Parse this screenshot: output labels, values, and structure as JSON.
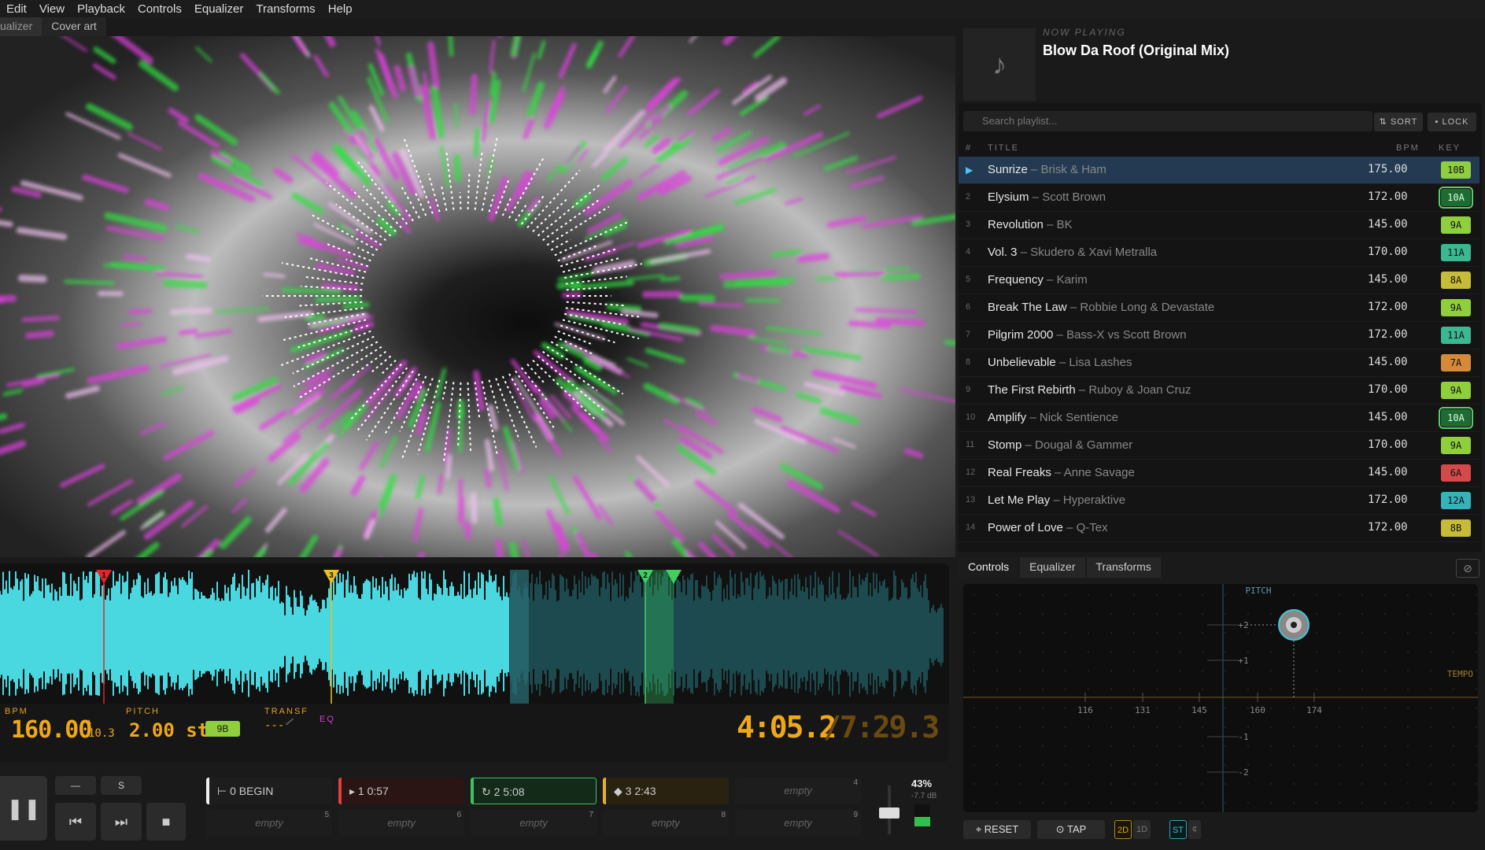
{
  "menu": [
    "Edit",
    "View",
    "Playback",
    "Controls",
    "Equalizer",
    "Transforms",
    "Help"
  ],
  "tabs": [
    "ualizer",
    "Cover art"
  ],
  "now_playing": {
    "label": "NOW PLAYING",
    "title": "Blow Da Roof (Original Mix)",
    "cover_icon": "♪"
  },
  "playlist": {
    "search_placeholder": "Search playlist...",
    "sort_label": "⇅ SORT",
    "lock_label": "▪ LOCK",
    "headers": {
      "num": "#",
      "title": "TITLE",
      "bpm": "BPM",
      "key": "KEY"
    },
    "rows": [
      {
        "num": "▶",
        "title": "Sunrize",
        "artist": "Brisk & Ham",
        "bpm": "175.00",
        "key": "10B",
        "color": "#8fcf3e"
      },
      {
        "num": "2",
        "title": "Elysium",
        "artist": "Scott Brown",
        "bpm": "172.00",
        "key": "10A",
        "color": "#58c96a"
      },
      {
        "num": "3",
        "title": "Revolution",
        "artist": "BK",
        "bpm": "145.00",
        "key": "9A",
        "color": "#8fcf3e"
      },
      {
        "num": "4",
        "title": "Vol. 3",
        "artist": "Skudero & Xavi Metralla",
        "bpm": "170.00",
        "key": "11A",
        "color": "#3bb88f"
      },
      {
        "num": "5",
        "title": "Frequency",
        "artist": "Karim",
        "bpm": "145.00",
        "key": "8A",
        "color": "#c7bb3a"
      },
      {
        "num": "6",
        "title": "Break The Law",
        "artist": "Robbie Long & Devastate",
        "bpm": "172.00",
        "key": "9A",
        "color": "#8fcf3e"
      },
      {
        "num": "7",
        "title": "Pilgrim 2000",
        "artist": "Bass-X vs Scott Brown",
        "bpm": "172.00",
        "key": "11A",
        "color": "#3bb88f"
      },
      {
        "num": "8",
        "title": "Unbelievable",
        "artist": "Lisa Lashes",
        "bpm": "145.00",
        "key": "7A",
        "color": "#d48a3a"
      },
      {
        "num": "9",
        "title": "The First Rebirth",
        "artist": "Ruboy & Joan Cruz",
        "bpm": "170.00",
        "key": "9A",
        "color": "#8fcf3e"
      },
      {
        "num": "10",
        "title": "Amplify",
        "artist": "Nick Sentience",
        "bpm": "145.00",
        "key": "10A",
        "color": "#58c96a"
      },
      {
        "num": "11",
        "title": "Stomp",
        "artist": "Dougal & Gammer",
        "bpm": "170.00",
        "key": "9A",
        "color": "#8fcf3e"
      },
      {
        "num": "12",
        "title": "Real Freaks",
        "artist": "Anne Savage",
        "bpm": "145.00",
        "key": "6A",
        "color": "#d44a4a"
      },
      {
        "num": "13",
        "title": "Let Me Play",
        "artist": "Hyperaktive",
        "bpm": "172.00",
        "key": "12A",
        "color": "#37b2b8"
      },
      {
        "num": "14",
        "title": "Power of Love",
        "artist": "Q-Tex",
        "bpm": "172.00",
        "key": "8B",
        "color": "#c7bb3a"
      }
    ]
  },
  "deck": {
    "bpm_label": "BPM",
    "bpm": "160.00",
    "bpm_delta": "10.3",
    "pitch_label": "PITCH",
    "pitch": "2.00 st",
    "key": "9B",
    "transf_label": "TRANSF",
    "transf_val": "---",
    "eq_label": "EQ",
    "elapsed": "4:05.2",
    "total": "/7:29.3",
    "markers": [
      "1",
      "3",
      "2"
    ]
  },
  "transport": {
    "minus": "—",
    "s": "S",
    "pause": "❚❚",
    "prev": "⏮",
    "next": "⏭",
    "stop": "■"
  },
  "cues": [
    {
      "label": "⊢ 0 BEGIN",
      "n": "",
      "color": "#eee"
    },
    {
      "label": "▸ 1 0:57",
      "n": "",
      "color": "#e04040"
    },
    {
      "label": "↻ 2 5:08",
      "n": "",
      "color": "#40c060"
    },
    {
      "label": "◆ 3 2:43",
      "n": "",
      "color": "#e0b030"
    },
    {
      "label": "empty",
      "n": "4"
    },
    {
      "label": "empty",
      "n": "5"
    },
    {
      "label": "empty",
      "n": "6"
    },
    {
      "label": "empty",
      "n": "7"
    },
    {
      "label": "empty",
      "n": "8"
    },
    {
      "label": "empty",
      "n": "9"
    }
  ],
  "volume": {
    "percent": "43%",
    "db": "-7.7 dB"
  },
  "right_tabs": [
    "Controls",
    "Equalizer",
    "Transforms"
  ],
  "right_tab_icon": "⊘",
  "pad": {
    "pitch_label": "PITCH",
    "tempo_label": "TEMPO",
    "x_ticks": [
      "116",
      "131",
      "145",
      "160",
      "174"
    ],
    "y_ticks": [
      "+2",
      "+1",
      "-1",
      "-2"
    ]
  },
  "pad_buttons": {
    "reset": "⌖ RESET",
    "tap": "⊙ TAP",
    "b2d": "2D",
    "b1d": "1D",
    "st": "ST",
    "c": "¢"
  }
}
